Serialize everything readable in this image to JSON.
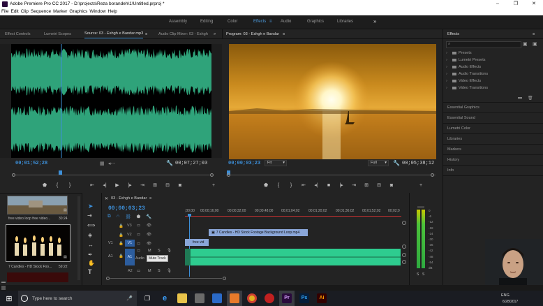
{
  "window": {
    "title": "Adobe Premiere Pro CC 2017 - D:\\projects\\Reza borandeh\\1\\Untitled.prproj *",
    "controls": [
      "–",
      "❐",
      "✕"
    ]
  },
  "menu": [
    "File",
    "Edit",
    "Clip",
    "Sequence",
    "Marker",
    "Graphics",
    "Window",
    "Help"
  ],
  "workspaces": {
    "tabs": [
      "Assembly",
      "Editing",
      "Color",
      "Effects",
      "Audio",
      "Graphics",
      "Libraries"
    ],
    "active": "Effects",
    "more": "»"
  },
  "source": {
    "tabs": [
      "Effect Controls",
      "Lumetri Scopes",
      "Source: 03 - Eshgh e Bandar.mp3",
      "Audio Clip Mixer: 03 - Eshgh"
    ],
    "timecode_in": "00;01;52;28",
    "timecode_duration": "00;07;27;03"
  },
  "program": {
    "title": "Program: 03 - Eshgh e Bandar",
    "timecode": "00;00;03;23",
    "fit": "Fit",
    "quality": "Full",
    "duration": "00;05;38;12"
  },
  "effects": {
    "title": "Effects",
    "tree": [
      "Presets",
      "Lumetri Presets",
      "Audio Effects",
      "Audio Transitions",
      "Video Effects",
      "Video Transitions"
    ],
    "sections": [
      "Essential Graphics",
      "Essential Sound",
      "Lumetri Color",
      "Libraries",
      "Markers",
      "History",
      "Info"
    ]
  },
  "project": {
    "items": [
      {
        "name": "free video loop free video...",
        "duration": "30:24"
      },
      {
        "name": "7 Candles - HD Stock Foo...",
        "duration": "59:22"
      }
    ]
  },
  "timeline": {
    "sequence": "03 - Eshgh e Bandar",
    "timecode": "00;00;03;23",
    "ruler": [
      ";00;00",
      "00;00;16;00",
      "00;00;32;00",
      "00;00;48;00",
      "00;01;04;02",
      "00;01;20;02",
      "00;01;36;02",
      "00;01;52;02",
      "00;02;0"
    ],
    "tracks": [
      "V3",
      "V2",
      "V1",
      "A1",
      "A2"
    ],
    "clips": {
      "v2": "7 Candles - HD Stock Footage Background Loop.mp4",
      "v1": "free vid",
      "a1_label": "Audio",
      "tooltip": "Mute Track"
    }
  },
  "meters": {
    "scale": [
      "0",
      "-6",
      "-12",
      "-18",
      "-24",
      "-30",
      "-36",
      "-42",
      "-48",
      "-54",
      "dB"
    ],
    "solo": [
      "S",
      "S"
    ]
  },
  "taskbar": {
    "search_placeholder": "Type here to search",
    "lang": "ENG",
    "date": "6/28/2017"
  },
  "colors": {
    "accent": "#3d8fd8",
    "waveform": "#2fa37a",
    "audio_clip": "#2ecc8f",
    "video_clip": "#8aa6d8"
  }
}
